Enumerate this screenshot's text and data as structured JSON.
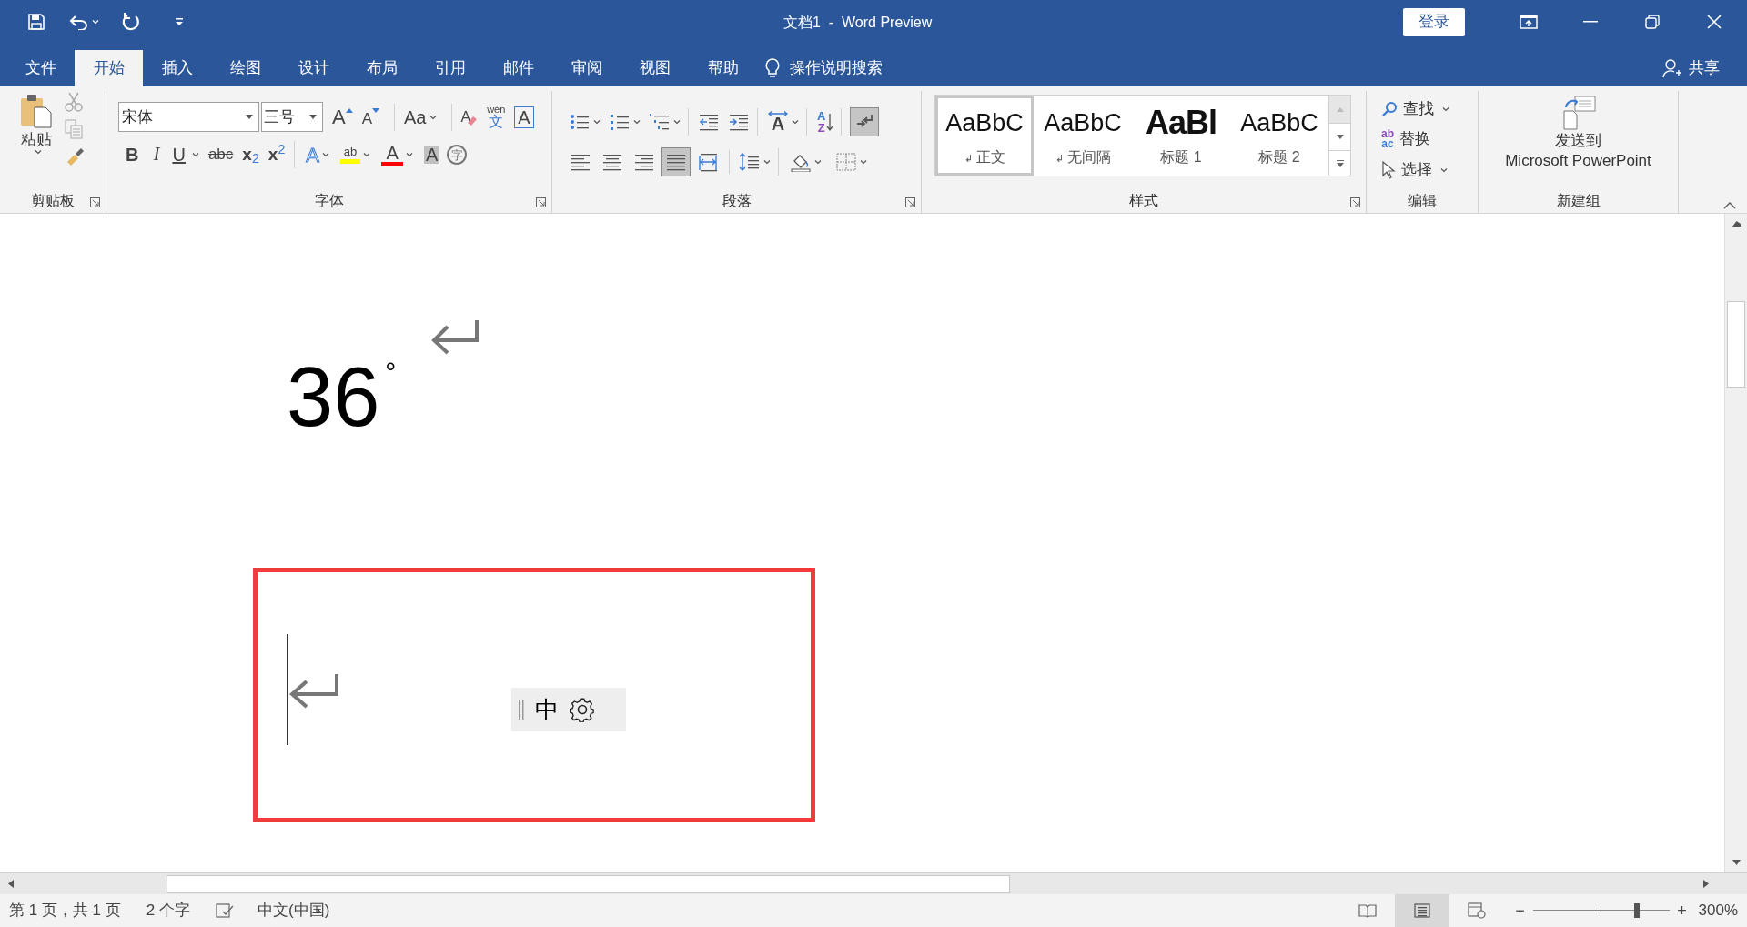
{
  "window": {
    "title": "文档1  -  Word Preview",
    "sign_in": "登录"
  },
  "tabs": [
    {
      "label": "文件",
      "selected": false
    },
    {
      "label": "开始",
      "selected": true
    },
    {
      "label": "插入",
      "selected": false
    },
    {
      "label": "绘图",
      "selected": false
    },
    {
      "label": "设计",
      "selected": false
    },
    {
      "label": "布局",
      "selected": false
    },
    {
      "label": "引用",
      "selected": false
    },
    {
      "label": "邮件",
      "selected": false
    },
    {
      "label": "审阅",
      "selected": false
    },
    {
      "label": "视图",
      "selected": false
    },
    {
      "label": "帮助",
      "selected": false
    }
  ],
  "tell_me": "操作说明搜索",
  "share": "共享",
  "ribbon": {
    "clipboard": {
      "paste": "粘贴",
      "label": "剪贴板"
    },
    "font": {
      "label": "字体",
      "font_name": "宋体",
      "font_size": "三号",
      "row1": [
        {
          "kind": "grow",
          "text": "A"
        },
        {
          "kind": "shrink",
          "text": "A"
        },
        {
          "kind": "case",
          "text": "Aa"
        },
        {
          "kind": "clear",
          "text": "A"
        },
        {
          "kind": "phonetic",
          "text": "文",
          "ruby": "wén"
        },
        {
          "kind": "border",
          "text": "A"
        }
      ],
      "row2": [
        {
          "kind": "bold",
          "text": "B"
        },
        {
          "kind": "italic",
          "text": "I"
        },
        {
          "kind": "underline",
          "text": "U"
        },
        {
          "kind": "strike",
          "text": "abc"
        },
        {
          "kind": "subscript",
          "text": "x$_{2}$"
        },
        {
          "kind": "superscript",
          "text": "x$^{2}$"
        },
        {
          "kind": "effects",
          "text": "A"
        },
        {
          "kind": "highlight",
          "text": "ab"
        },
        {
          "kind": "color",
          "text": "A"
        },
        {
          "kind": "shading",
          "text": "A"
        },
        {
          "kind": "enclose",
          "text": "字"
        }
      ]
    },
    "paragraph": {
      "label": "段落",
      "text_direction": "A",
      "sort": [
        "A",
        "Z"
      ],
      "show_marks": {
        "on": true
      },
      "alignments": [
        {
          "kind": "left",
          "selected": false
        },
        {
          "kind": "center",
          "selected": false
        },
        {
          "kind": "right",
          "selected": false
        },
        {
          "kind": "justify",
          "selected": true
        },
        {
          "kind": "distributed",
          "selected": false
        }
      ]
    },
    "styles": {
      "label": "样式",
      "items": [
        {
          "kind": "normal",
          "preview": "AaBbC",
          "mark": "↲",
          "name": "正文",
          "selected": true
        },
        {
          "kind": "normal",
          "preview": "AaBbC",
          "mark": "↲",
          "name": "无间隔",
          "selected": false
        },
        {
          "kind": "heading1",
          "preview": "AaBl",
          "name": "标题 1",
          "selected": false
        },
        {
          "kind": "heading2",
          "preview": "AaBbC",
          "name": "标题 2",
          "selected": false
        }
      ]
    },
    "editing": {
      "label": "编辑",
      "find": "查找",
      "replace": "替换",
      "replace_icon": [
        "ab",
        "ac"
      ],
      "select": "选择"
    },
    "new_group": {
      "label": "新建组",
      "button": [
        "发送到",
        "Microsoft PowerPoint"
      ]
    }
  },
  "document": {
    "text": "36",
    "superscript": "°",
    "ime": {
      "mode": "中"
    }
  },
  "status_bar": {
    "page": "第 1 页，共 1 页",
    "words": "2 个字",
    "language": "中文(中国)",
    "views": [
      {
        "selected": false
      },
      {
        "selected": true
      },
      {
        "selected": false
      }
    ],
    "zoom_out": "−",
    "zoom": {
      "level": 0.76
    },
    "zoom_in": "+",
    "zoom_percent": "300%"
  }
}
